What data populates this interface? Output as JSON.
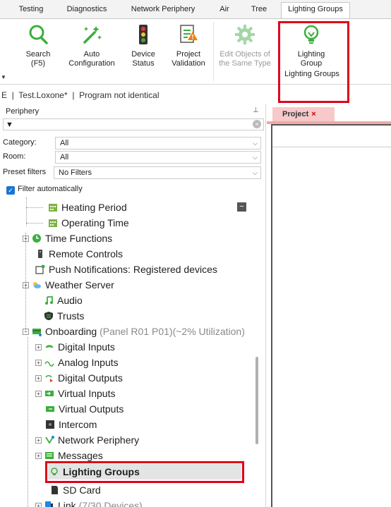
{
  "tabs": [
    {
      "label": "Testing"
    },
    {
      "label": "Diagnostics"
    },
    {
      "label": "Network Periphery"
    },
    {
      "label": "Air"
    },
    {
      "label": "Tree"
    },
    {
      "label": "Lighting Groups"
    }
  ],
  "ribbon": {
    "buttons": [
      {
        "label": "Search",
        "sub": "(F5)",
        "icon": "search-icon"
      },
      {
        "label": "Auto",
        "sub": "Configuration",
        "icon": "magic-wand-icon"
      },
      {
        "label": "Device",
        "sub": "Status",
        "icon": "traffic-light-icon"
      },
      {
        "label": "Project",
        "sub": "Validation",
        "icon": "validation-icon"
      },
      {
        "label": "Edit Objects of",
        "sub": "the Same Type",
        "icon": "gear-icon"
      },
      {
        "label": "Lighting",
        "sub": "Group",
        "icon": "lightbulb-icon"
      }
    ],
    "group_label": "Lighting Groups"
  },
  "status": {
    "prefix": "E",
    "project": "Test.Loxone*",
    "state": "Program not identical"
  },
  "panel": {
    "title": "Periphery",
    "filters": {
      "category_label": "Category:",
      "category_value": "All",
      "room_label": "Room:",
      "room_value": "All",
      "preset_label": "Preset filters",
      "preset_value": "No Filters",
      "auto_label": "Filter automatically"
    }
  },
  "tree": [
    {
      "label": "Heating Period",
      "extra": ""
    },
    {
      "label": "Operating Time",
      "extra": ""
    },
    {
      "label": "Time Functions",
      "extra": ""
    },
    {
      "label": "Remote Controls",
      "extra": ""
    },
    {
      "label": "Push Notifications: Registered devices",
      "extra": ""
    },
    {
      "label": "Weather Server",
      "extra": ""
    },
    {
      "label": "Audio",
      "extra": ""
    },
    {
      "label": "Trusts",
      "extra": ""
    },
    {
      "label": "Onboarding",
      "extra": "(Panel R01 P01)(~2% Utilization)"
    },
    {
      "label": "Digital Inputs",
      "extra": ""
    },
    {
      "label": "Analog Inputs",
      "extra": ""
    },
    {
      "label": "Digital Outputs",
      "extra": ""
    },
    {
      "label": "Virtual Inputs",
      "extra": ""
    },
    {
      "label": "Virtual Outputs",
      "extra": ""
    },
    {
      "label": "Intercom",
      "extra": ""
    },
    {
      "label": "Network Periphery",
      "extra": ""
    },
    {
      "label": "Messages",
      "extra": ""
    },
    {
      "label": "Lighting Groups",
      "extra": ""
    },
    {
      "label": "SD Card",
      "extra": ""
    },
    {
      "label": "Link",
      "extra": "(7/30 Devices)"
    }
  ],
  "document": {
    "tab_label": "Project"
  },
  "colors": {
    "highlight": "#e0001a",
    "accent_green": "#3cae3c",
    "checkbox_blue": "#1976d2"
  }
}
